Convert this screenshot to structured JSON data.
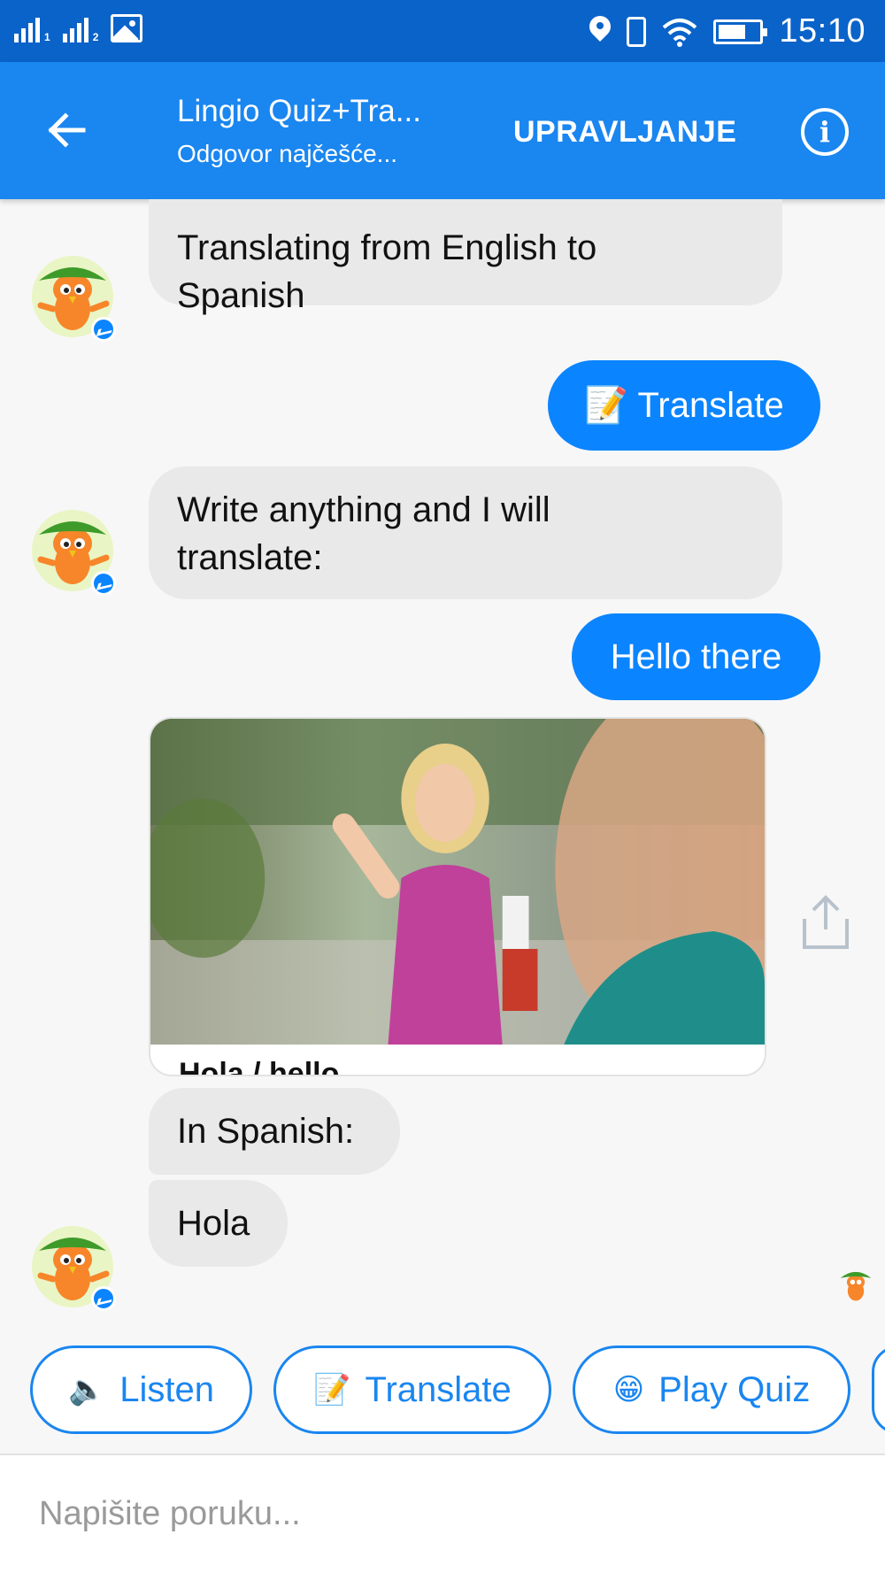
{
  "status_bar": {
    "sim1": "1",
    "sim2": "2",
    "time": "15:10"
  },
  "header": {
    "title": "Lingio Quiz+Tra...",
    "subtitle": "Odgovor najčešće...",
    "manage_label": "UPRAVLJANJE",
    "info_glyph": "i"
  },
  "messages": {
    "bot_1": [
      "Translating from English to",
      "Spanish"
    ],
    "user_1": "📝 Translate",
    "bot_2": [
      "Write anything and I will",
      "translate:"
    ],
    "user_2": "Hello there",
    "card_caption": "Hola / hello",
    "bot_3": "In Spanish:",
    "bot_4": "Hola"
  },
  "quick_replies": [
    {
      "label": "Listen",
      "icon": "speaker-icon",
      "glyph": "🔈"
    },
    {
      "label": "Translate",
      "icon": "memo-icon",
      "glyph": "📝"
    },
    {
      "label": "Play Quiz",
      "icon": "grin-icon",
      "glyph": "😁"
    }
  ],
  "composer": {
    "placeholder": "Napišite poruku..."
  },
  "colors": {
    "status_bar": "#0a63c9",
    "app_bar": "#1a86f0",
    "user_bubble": "#0b84ff",
    "bot_bubble": "#e9e9e9"
  }
}
